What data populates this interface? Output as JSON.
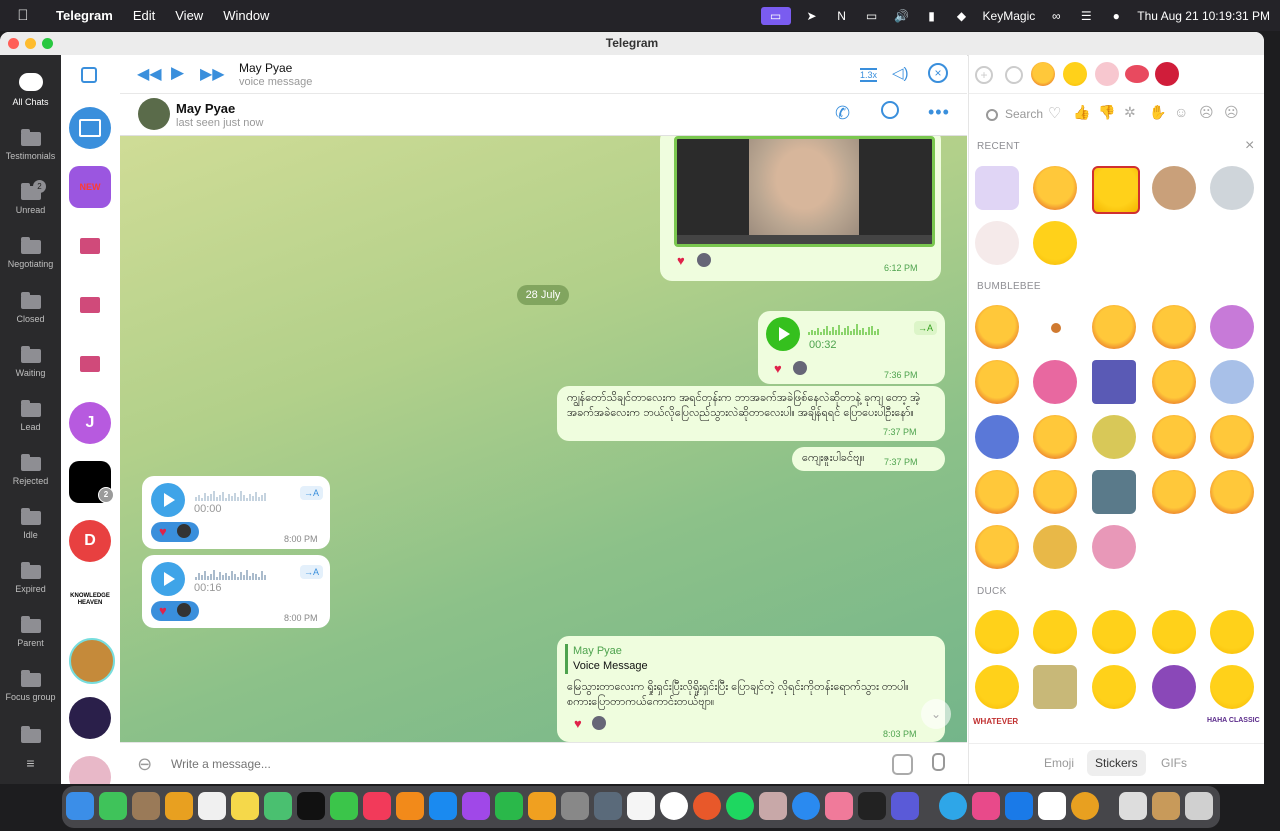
{
  "menubar": {
    "app": "Telegram",
    "items": [
      "Edit",
      "View",
      "Window"
    ],
    "keymagic": "KeyMagic",
    "datetime": "Thu Aug 21  10:19:31 PM"
  },
  "window": {
    "title": "Telegram"
  },
  "folders": [
    {
      "label": "All Chats",
      "active": true
    },
    {
      "label": "Testimonials"
    },
    {
      "label": "Unread",
      "count": "2"
    },
    {
      "label": "Negotiating"
    },
    {
      "label": "Closed"
    },
    {
      "label": "Waiting"
    },
    {
      "label": "Lead"
    },
    {
      "label": "Rejected"
    },
    {
      "label": "Idle"
    },
    {
      "label": "Expired"
    },
    {
      "label": "Parent"
    },
    {
      "label": "Focus group"
    }
  ],
  "chat_avatars": {
    "j_letter": "J",
    "d_letter": "D",
    "badge_count": "2",
    "knowledge_text": "KNOWLEDGE HEAVEN"
  },
  "player": {
    "name": "May Pyae",
    "subtitle": "voice message",
    "speed": "1.3x"
  },
  "header": {
    "name": "May Pyae",
    "status": "last seen just now"
  },
  "messages": {
    "video_time": "6:12 PM",
    "date_separator": "28 July",
    "voice_out": {
      "duration": "00:32",
      "time": "7:36 PM",
      "transcribe": "→A"
    },
    "text1": {
      "body": "ကျွန်တော်သိချင်တာလေးက အရင်တုန်းက ဘာအခက်အခဲဖြစ်နေလဲဆိုတာနဲ့ ခုကျ တော့ အဲ့အခက်အခဲလေးက ဘယ်လိုပြေလည်သွားလဲဆိုတာလေးပါ။ အချိန်ရရင် ပြောပေးပါဦးနော်။",
      "time": "7:37 PM"
    },
    "text2": {
      "body": "ကျေးဇူးပါခင်ဗျ။",
      "time": "7:37 PM"
    },
    "voice_in1": {
      "duration": "00:00",
      "time": "8:00 PM",
      "transcribe": "→A"
    },
    "voice_in2": {
      "duration": "00:16",
      "time": "8:00 PM",
      "transcribe": "→A"
    },
    "reply": {
      "quote_name": "May Pyae",
      "quote_text": "Voice Message",
      "body": "မြေသွားတာလေးက ရှိုးရှင်းပြီးလိုရှိုးရှင်းပြီး ပြောချင်တဲ့ လိုရင်းကိုတန်းရောက်သွား တာပါ။ စကားပြောတာကယ်ကောင်းတယ်ဗျာ။",
      "time": "8:03 PM"
    }
  },
  "composer": {
    "placeholder": "Write a message..."
  },
  "stickers": {
    "search_placeholder": "Search",
    "sections": [
      "RECENT",
      "BUMBLEBEE",
      "DUCK"
    ],
    "duck_text1": "WHATEVER",
    "duck_text2": "HAHA CLASSIC",
    "tabs": [
      "Emoji",
      "Stickers",
      "GIFs"
    ],
    "active_tab": "Stickers"
  }
}
